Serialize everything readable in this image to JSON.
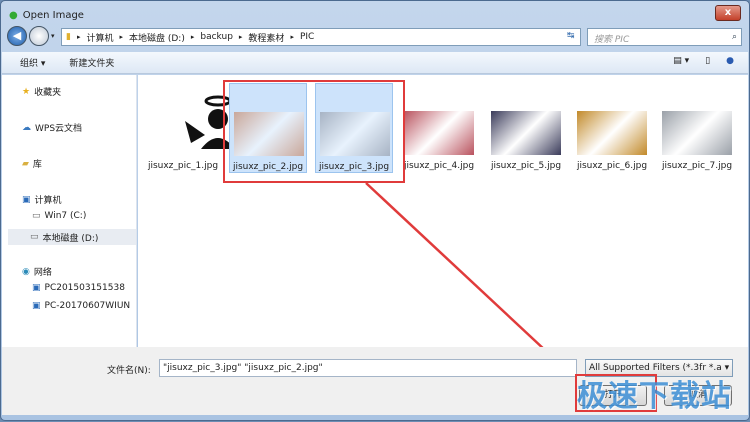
{
  "window": {
    "title": "Open Image",
    "close": "x"
  },
  "address": {
    "crumbs": [
      "计算机",
      "本地磁盘 (D:)",
      "backup",
      "教程素材",
      "PIC"
    ]
  },
  "search": {
    "placeholder": "搜索 PIC"
  },
  "toolbar": {
    "organize": "组织 ▾",
    "new_folder": "新建文件夹"
  },
  "sidebar": {
    "items": [
      {
        "label": "收藏夹",
        "icon": "star-icon"
      },
      {
        "label": "WPS云文档",
        "icon": "cloud-icon"
      },
      {
        "label": "库",
        "icon": "library-icon"
      },
      {
        "label": "计算机",
        "icon": "computer-icon"
      },
      {
        "label": "Win7 (C:)",
        "icon": "drive-icon"
      },
      {
        "label": "本地磁盘 (D:)",
        "icon": "drive-icon",
        "selected": true
      },
      {
        "label": "网络",
        "icon": "network-icon"
      },
      {
        "label": "PC201503151538",
        "icon": "computer-icon"
      },
      {
        "label": "PC-20170607WIUN",
        "icon": "computer-icon"
      }
    ]
  },
  "files": [
    {
      "name": "jisuxz_pic_1.jpg",
      "selected": false,
      "color": "#111111"
    },
    {
      "name": "jisuxz_pic_2.jpg",
      "selected": true,
      "color": "#c9a79a"
    },
    {
      "name": "jisuxz_pic_3.jpg",
      "selected": true,
      "color": "#a7b3c4"
    },
    {
      "name": "jisuxz_pic_4.jpg",
      "selected": false,
      "color": "#b9525e"
    },
    {
      "name": "jisuxz_pic_5.jpg",
      "selected": false,
      "color": "#3a3b5a"
    },
    {
      "name": "jisuxz_pic_6.jpg",
      "selected": false,
      "color": "#c28a2a"
    },
    {
      "name": "jisuxz_pic_7.jpg",
      "selected": false,
      "color": "#9aa0a8"
    }
  ],
  "bottom": {
    "filename_label": "文件名(N):",
    "filename_value": "\"jisuxz_pic_3.jpg\" \"jisuxz_pic_2.jpg\"",
    "filter": "All Supported Filters (*.3fr *.a ▾",
    "open": "打开",
    "cancel": "取消"
  },
  "watermark": "极速下载站",
  "colors": {
    "highlight": "#e03b3b",
    "selection": "#cde3fb"
  }
}
